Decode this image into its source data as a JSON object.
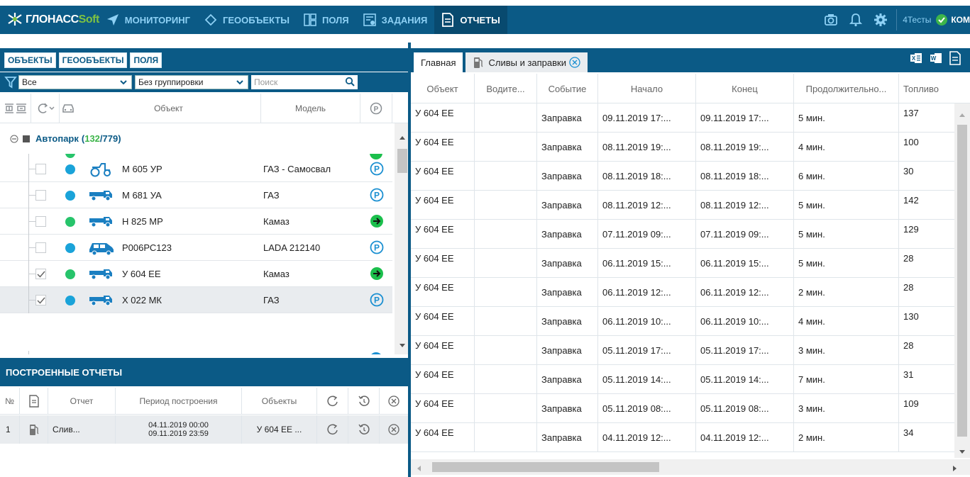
{
  "brand": {
    "main": "ГЛОНАСС",
    "soft": "Soft"
  },
  "nav": [
    {
      "label": "МОНИТОРИНГ",
      "icon": "send-icon"
    },
    {
      "label": "ГЕООБЪЕКТЫ",
      "icon": "diamond-icon"
    },
    {
      "label": "ПОЛЯ",
      "icon": "fields-icon"
    },
    {
      "label": "ЗАДАНИЯ",
      "icon": "tasks-icon"
    },
    {
      "label": "ОТЧЕТЫ",
      "icon": "reports-icon",
      "active": true
    }
  ],
  "topbar": {
    "user": "4Тесты",
    "company": "КОМ"
  },
  "object_tabs": [
    "ОБЪЕКТЫ",
    "ГЕООБЪЕКТЫ",
    "ПОЛЯ"
  ],
  "filters": {
    "filter_value": "Все",
    "grouping_value": "Без группировки",
    "search_placeholder": "Поиск"
  },
  "object_columns": {
    "object": "Объект",
    "model": "Модель"
  },
  "group": {
    "name": "Автопарк",
    "online": "132",
    "total": "779"
  },
  "objects": [
    {
      "plate": "М 605 УР",
      "model": "ГАЗ - Самосвал",
      "dot": "#1aa3d9",
      "vehicle": "tractor",
      "status": "parking",
      "checked": false,
      "selected": false
    },
    {
      "plate": "М 681 УА",
      "model": "ГАЗ",
      "dot": "#1aa3d9",
      "vehicle": "truck",
      "status": "parking",
      "checked": false,
      "selected": false
    },
    {
      "plate": "Н 825 МР",
      "model": "Камаз",
      "dot": "#27c46b",
      "vehicle": "truck",
      "status": "moving",
      "checked": false,
      "selected": false
    },
    {
      "plate": "Р006РС123",
      "model": "LADA 212140",
      "dot": "#1aa3d9",
      "vehicle": "car",
      "status": "parking",
      "checked": false,
      "selected": false
    },
    {
      "plate": "У 604 ЕЕ",
      "model": "Камаз",
      "dot": "#27c46b",
      "vehicle": "truck",
      "status": "moving",
      "checked": true,
      "selected": false
    },
    {
      "plate": "Х 022 МК",
      "model": "ГАЗ",
      "dot": "#1aa3d9",
      "vehicle": "truck",
      "status": "parking",
      "checked": true,
      "selected": true
    }
  ],
  "built_reports": {
    "title": "ПОСТРОЕННЫЕ ОТЧЕТЫ",
    "columns": {
      "num": "№",
      "report": "Отчет",
      "period": "Период построения",
      "objects": "Объекты"
    },
    "rows": [
      {
        "num": "1",
        "report": "Слив...",
        "period_from": "04.11.2019 00:00",
        "period_to": "09.11.2019 23:59",
        "objects": "У 604 ЕЕ ..."
      }
    ]
  },
  "report_tabs": {
    "main": "Главная",
    "report": "Сливы и заправки"
  },
  "grid": {
    "columns": [
      "Объект",
      "Водите...",
      "Событие",
      "Начало",
      "Конец",
      "Продолжительно...",
      "Топливо"
    ],
    "rows": [
      [
        "У 604 ЕЕ",
        "",
        "Заправка",
        "09.11.2019 17:...",
        "09.11.2019 17:...",
        "5 мин.",
        "137"
      ],
      [
        "У 604 ЕЕ",
        "",
        "Заправка",
        "08.11.2019 19:...",
        "08.11.2019 19:...",
        "4 мин.",
        "100"
      ],
      [
        "У 604 ЕЕ",
        "",
        "Заправка",
        "08.11.2019 18:...",
        "08.11.2019 18:...",
        "6 мин.",
        "30"
      ],
      [
        "У 604 ЕЕ",
        "",
        "Заправка",
        "08.11.2019 12:...",
        "08.11.2019 12:...",
        "5 мин.",
        "142"
      ],
      [
        "У 604 ЕЕ",
        "",
        "Заправка",
        "07.11.2019 09:...",
        "07.11.2019 09:...",
        "5 мин.",
        "129"
      ],
      [
        "У 604 ЕЕ",
        "",
        "Заправка",
        "06.11.2019 15:...",
        "06.11.2019 15:...",
        "5 мин.",
        "28"
      ],
      [
        "У 604 ЕЕ",
        "",
        "Заправка",
        "06.11.2019 12:...",
        "06.11.2019 12:...",
        "2 мин.",
        "28"
      ],
      [
        "У 604 ЕЕ",
        "",
        "Заправка",
        "06.11.2019 10:...",
        "06.11.2019 10:...",
        "4 мин.",
        "130"
      ],
      [
        "У 604 ЕЕ",
        "",
        "Заправка",
        "05.11.2019 17:...",
        "05.11.2019 17:...",
        "3 мин.",
        "28"
      ],
      [
        "У 604 ЕЕ",
        "",
        "Заправка",
        "05.11.2019 14:...",
        "05.11.2019 14:...",
        "7 мин.",
        "31"
      ],
      [
        "У 604 ЕЕ",
        "",
        "Заправка",
        "05.11.2019 08:...",
        "05.11.2019 08:...",
        "3 мин.",
        "109"
      ],
      [
        "У 604 ЕЕ",
        "",
        "Заправка",
        "04.11.2019 12:...",
        "04.11.2019 12:...",
        "2 мин.",
        "34"
      ]
    ]
  },
  "colors": {
    "primary": "#0b5a86",
    "nav_text": "#8ed1f5",
    "accent_green": "#3db54a",
    "parking_blue": "#1a8fd1",
    "moving_green": "#1bbf4c"
  }
}
